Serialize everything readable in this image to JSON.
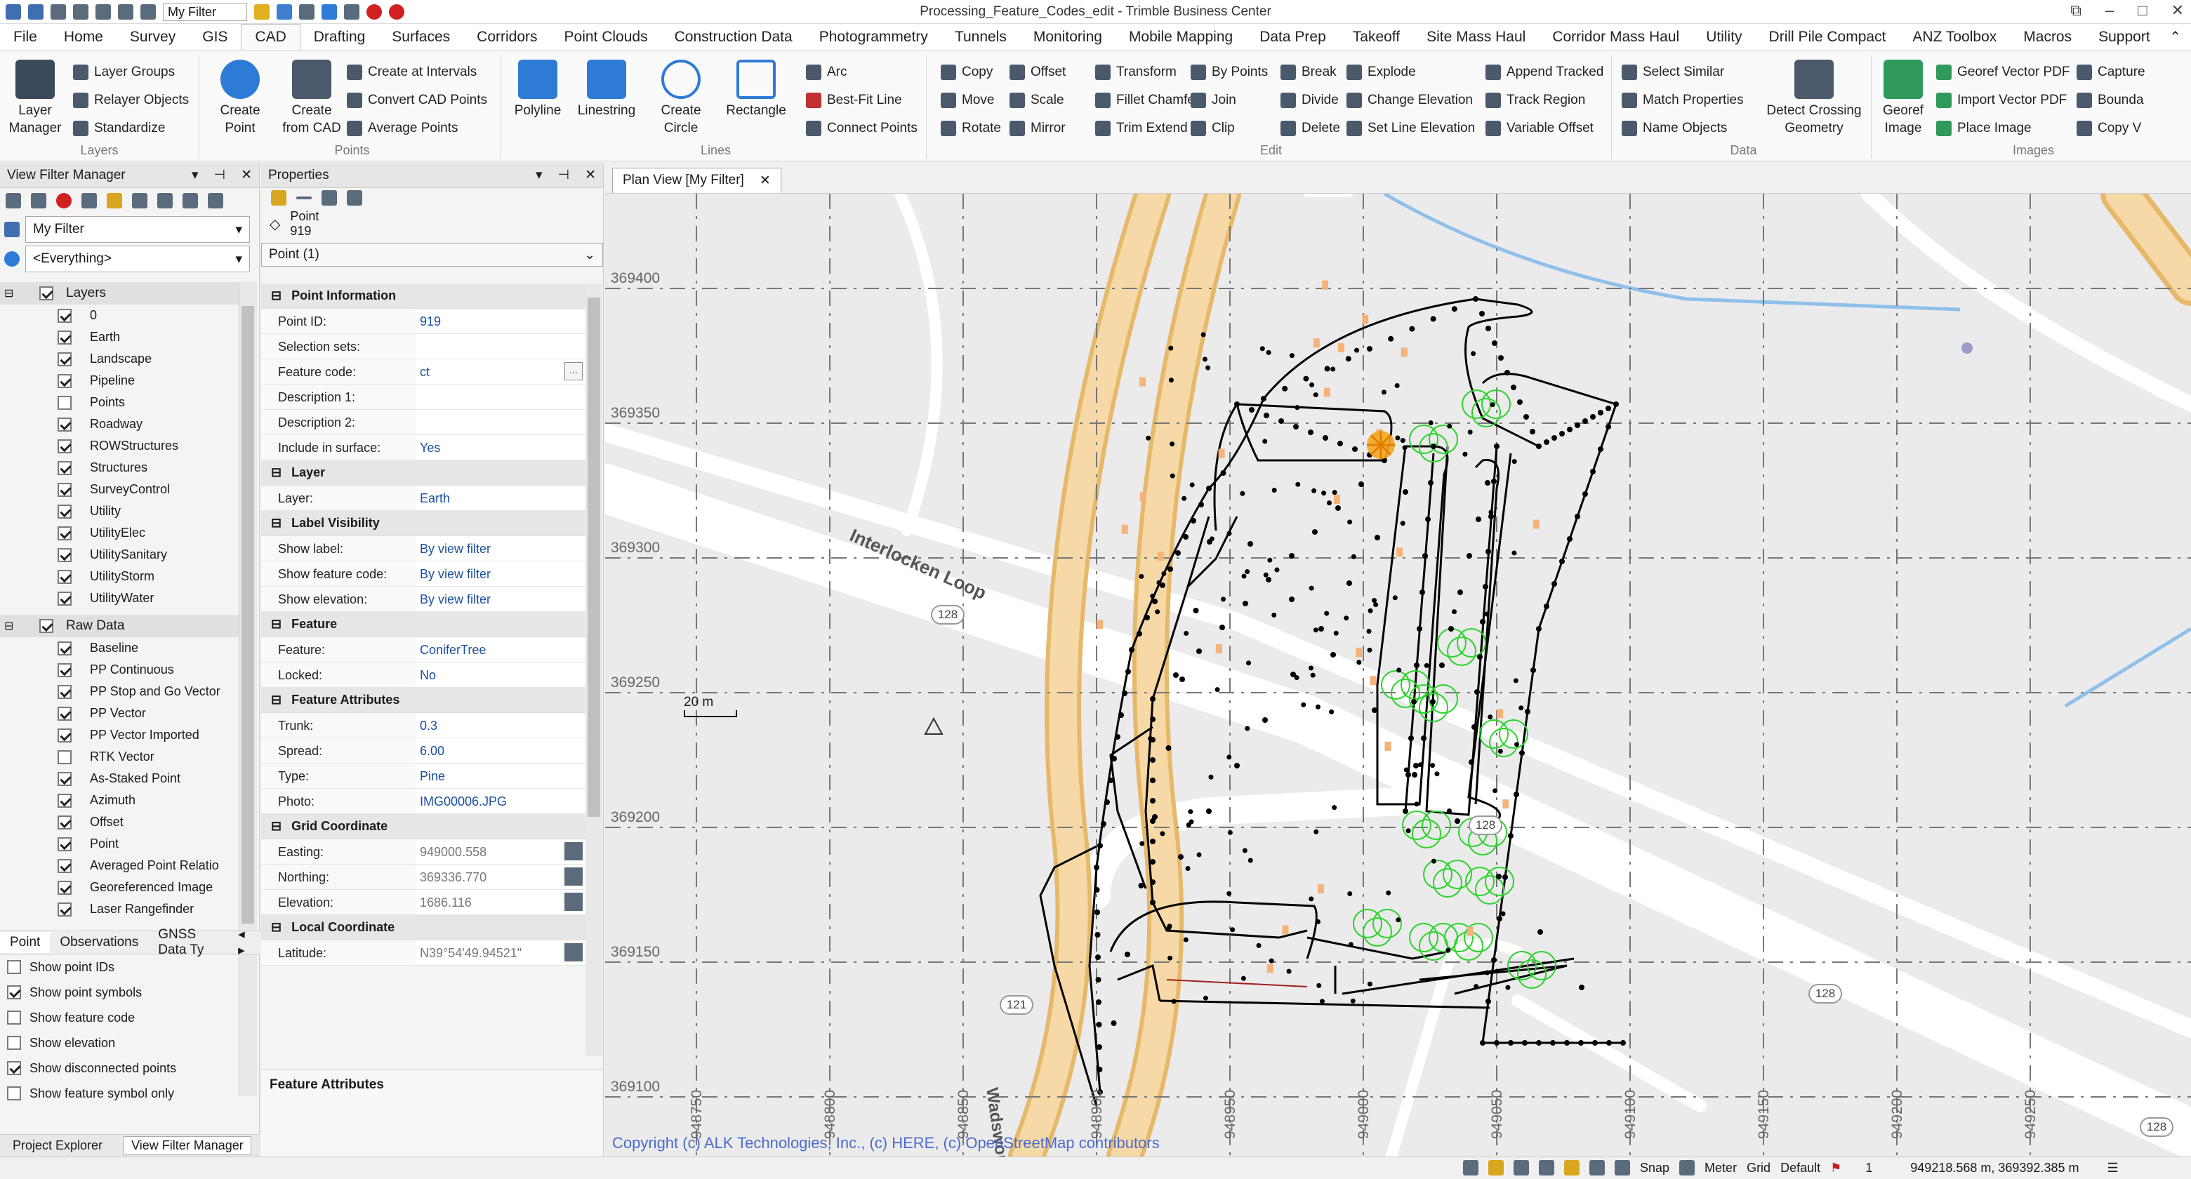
{
  "window": {
    "title": "Processing_Feature_Codes_edit - Trimble Business Center",
    "filter_value": "My Filter"
  },
  "menu": [
    "File",
    "Home",
    "Survey",
    "GIS",
    "CAD",
    "Drafting",
    "Surfaces",
    "Corridors",
    "Point Clouds",
    "Construction Data",
    "Photogrammetry",
    "Tunnels",
    "Monitoring",
    "Mobile Mapping",
    "Data Prep",
    "Takeoff",
    "Site Mass Haul",
    "Corridor Mass Haul",
    "Utility",
    "Drill Pile Compact",
    "ANZ Toolbox",
    "Macros",
    "Support"
  ],
  "ribbon": {
    "layers": {
      "name": "Layers",
      "big": "Layer\nManager",
      "items": [
        "Layer Groups",
        "Relayer Objects",
        "Standardize"
      ]
    },
    "points": {
      "name": "Points",
      "big1": "Create\nPoint",
      "big2": "Create\nfrom CAD",
      "items": [
        "Create at Intervals",
        "Convert CAD Points",
        "Average Points"
      ]
    },
    "lines": {
      "name": "Lines",
      "big1": "Polyline",
      "big2": "Linestring",
      "big3": "Create\nCircle",
      "big4": "Rectangle",
      "items": [
        "Arc",
        "Best-Fit Line",
        "Connect Points"
      ]
    },
    "edit": {
      "name": "Edit",
      "col1": [
        "Copy",
        "Move",
        "Rotate"
      ],
      "col2": [
        "Offset",
        "Scale",
        "Mirror"
      ],
      "col3": [
        "Transform",
        "Fillet Chamfer",
        "Trim Extend"
      ],
      "col4": [
        "By Points",
        "Join",
        "Clip"
      ],
      "col5": [
        "Break",
        "Divide",
        "Delete"
      ],
      "col6": [
        "Explode",
        "Change Elevation",
        "Set Line Elevation"
      ],
      "col7": [
        "Append Tracked",
        "Track Region",
        "Variable Offset"
      ]
    },
    "data": {
      "name": "Data",
      "items": [
        "Select Similar",
        "Match Properties",
        "Name Objects"
      ],
      "big": "Detect Crossing\nGeometry"
    },
    "images": {
      "name": "Images",
      "big": "Georef\nImage",
      "items": [
        "Georef Vector PDF",
        "Import Vector PDF",
        "Place Image"
      ],
      "items2": [
        "Capture",
        "Bounda",
        "Copy V"
      ]
    }
  },
  "vfm": {
    "title": "View Filter Manager",
    "filter": "My Filter",
    "scope": "<Everything>",
    "layers_label": "Layers",
    "layers": [
      {
        "n": "0",
        "c": true
      },
      {
        "n": "Earth",
        "c": true
      },
      {
        "n": "Landscape",
        "c": true
      },
      {
        "n": "Pipeline",
        "c": true
      },
      {
        "n": "Points",
        "c": false
      },
      {
        "n": "Roadway",
        "c": true
      },
      {
        "n": "ROWStructures",
        "c": true
      },
      {
        "n": "Structures",
        "c": true
      },
      {
        "n": "SurveyControl",
        "c": true
      },
      {
        "n": "Utility",
        "c": true
      },
      {
        "n": "UtilityElec",
        "c": true
      },
      {
        "n": "UtilitySanitary",
        "c": true
      },
      {
        "n": "UtilityStorm",
        "c": true
      },
      {
        "n": "UtilityWater",
        "c": true
      }
    ],
    "raw_label": "Raw Data",
    "raw": [
      {
        "n": "Baseline",
        "c": true
      },
      {
        "n": "PP Continuous",
        "c": true
      },
      {
        "n": "PP Stop and Go Vector",
        "c": true
      },
      {
        "n": "PP Vector",
        "c": true
      },
      {
        "n": "PP Vector Imported",
        "c": true
      },
      {
        "n": "RTK Vector",
        "c": false
      },
      {
        "n": "As-Staked Point",
        "c": true
      },
      {
        "n": "Azimuth",
        "c": true
      },
      {
        "n": "Offset",
        "c": true
      },
      {
        "n": "Point",
        "c": true
      },
      {
        "n": "Averaged Point Relatio",
        "c": true
      },
      {
        "n": "Georeferenced Image",
        "c": true
      },
      {
        "n": "Laser Rangefinder",
        "c": true
      }
    ],
    "tabs": [
      "Point",
      "Observations",
      "GNSS Data Ty"
    ],
    "options": [
      {
        "n": "Show point IDs",
        "c": false
      },
      {
        "n": "Show point symbols",
        "c": true
      },
      {
        "n": "Show feature code",
        "c": false
      },
      {
        "n": "Show elevation",
        "c": false
      },
      {
        "n": "Show disconnected points",
        "c": true
      },
      {
        "n": "Show feature symbol only",
        "c": false
      }
    ],
    "bottom_tabs": [
      "Project Explorer",
      "View Filter Manager"
    ]
  },
  "props": {
    "title": "Properties",
    "obj_type": "Point",
    "obj_id": "919",
    "selector": "Point (1)",
    "sections": [
      {
        "h": "Point Information",
        "rows": [
          [
            "Point ID:",
            "919"
          ],
          [
            "Selection sets:",
            ""
          ],
          [
            "Feature code:",
            "ct"
          ],
          [
            "Description 1:",
            ""
          ],
          [
            "Description 2:",
            ""
          ],
          [
            "Include in surface:",
            "Yes"
          ]
        ]
      },
      {
        "h": "Layer",
        "rows": [
          [
            "Layer:",
            "Earth"
          ]
        ]
      },
      {
        "h": "Label Visibility",
        "rows": [
          [
            "Show label:",
            "By view filter"
          ],
          [
            "Show feature code:",
            "By view filter"
          ],
          [
            "Show elevation:",
            "By view filter"
          ]
        ]
      },
      {
        "h": "Feature",
        "rows": [
          [
            "Feature:",
            "ConiferTree"
          ],
          [
            "Locked:",
            "No"
          ]
        ]
      },
      {
        "h": "Feature Attributes",
        "rows": [
          [
            "Trunk:",
            "0.3"
          ],
          [
            "Spread:",
            "6.00"
          ],
          [
            "Type:",
            "Pine"
          ],
          [
            "Photo:",
            "IMG00006.JPG"
          ]
        ]
      },
      {
        "h": "Grid Coordinate",
        "rows": [
          [
            "Easting:",
            "949000.558"
          ],
          [
            "Northing:",
            "369336.770"
          ],
          [
            "Elevation:",
            "1686.116"
          ]
        ]
      },
      {
        "h": "Local Coordinate",
        "rows": [
          [
            "Latitude:",
            "N39°54'49.94521\""
          ]
        ]
      }
    ],
    "footer": "Feature Attributes"
  },
  "plan": {
    "tab": "Plan View [My Filter]",
    "northings": [
      "369400",
      "369350",
      "369300",
      "369250",
      "369200",
      "369150",
      "369100"
    ],
    "eastings": [
      "948750",
      "948800",
      "948850",
      "948900",
      "948950",
      "949000",
      "949050",
      "949100",
      "949150",
      "949200",
      "949250"
    ],
    "roads": [
      "Interlocken Loop",
      "Wadsworth"
    ],
    "shields": [
      "128",
      "128",
      "128",
      "121",
      "128"
    ],
    "scale": "20 m",
    "copyright": "Copyright (c) ALK Technologies, Inc., (c) HERE, (c) OpenStreetMap contributors"
  },
  "status": {
    "snap": "Snap",
    "units": "Meter",
    "grid": "Grid",
    "profile": "Default",
    "count": "1",
    "coords": "949218.568 m, 369392.385 m"
  }
}
